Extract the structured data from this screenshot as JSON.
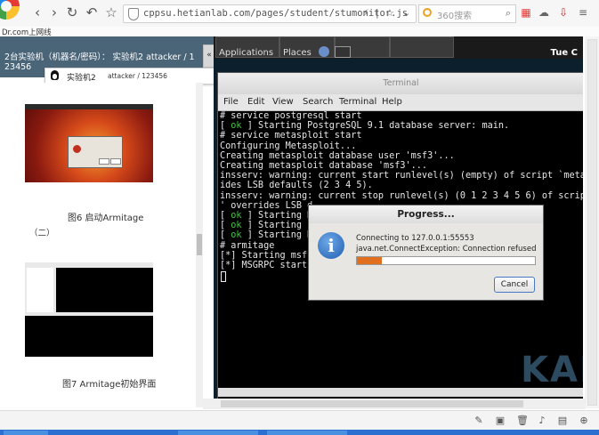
{
  "browser": {
    "url": "cppsu.hetianlab.com/pages/student/stumonitor.js",
    "search_placeholder": "360搜索",
    "bookmark": "Dr.com上网线"
  },
  "experiment": {
    "title": "2台实验机（机器名/密码）：  实验机2    attacker / 1",
    "id_suffix": "23456",
    "machine_name": "实验机2",
    "machine_cred": "attacker / 123456"
  },
  "document": {
    "fig6_caption": "图6 启动Armitage",
    "section_label": "（二）",
    "fig7_caption": "图7 Armitage初始界面"
  },
  "vm": {
    "menu_applications": "Applications",
    "menu_places": "Places",
    "clock": "Tue C"
  },
  "terminal": {
    "title": "Terminal",
    "menus": [
      "File",
      "Edit",
      "View",
      "Search",
      "Terminal",
      "Help"
    ],
    "lines": [
      {
        "text": "# service postgresql start"
      },
      {
        "ok": true,
        "text": " Starting PostgreSQL 9.1 database server: main."
      },
      {
        "text": "# service metasploit start"
      },
      {
        "text": "Configuring Metasploit..."
      },
      {
        "text": "Creating metasploit database user 'msf3'..."
      },
      {
        "text": "Creating metasploit database 'msf3'..."
      },
      {
        "text": "insserv: warning: current start runlevel(s) (empty) of script `meta"
      },
      {
        "text": "ides LSB defaults (2 3 4 5)."
      },
      {
        "text": "insserv: warning: current stop runlevel(s) (0 1 2 3 4 5 6) of scrip"
      },
      {
        "text": "' overrides LSB d"
      },
      {
        "ok": true,
        "text": " Starting M"
      },
      {
        "ok": true,
        "text": " Starting P"
      },
      {
        "ok": true,
        "text": " Starting M"
      },
      {
        "text": "# armitage"
      },
      {
        "text": "[*] Starting msf"
      },
      {
        "text": "[*] MSGRPC start"
      }
    ],
    "watermark": "KAL"
  },
  "progress_dialog": {
    "title": "Progress...",
    "message": "Connecting to 127.0.0.1:55553",
    "error": "java.net.ConnectException: Connection refused",
    "progress_fraction": 0.14,
    "cancel_label": "Cancel"
  },
  "colors": {
    "header_bg": "#4a6478",
    "terminal_bg": "#000000",
    "ok_green": "#3fc43f",
    "progress_orange": "#e07020",
    "taskbar_blue": "#2b6fd0"
  }
}
